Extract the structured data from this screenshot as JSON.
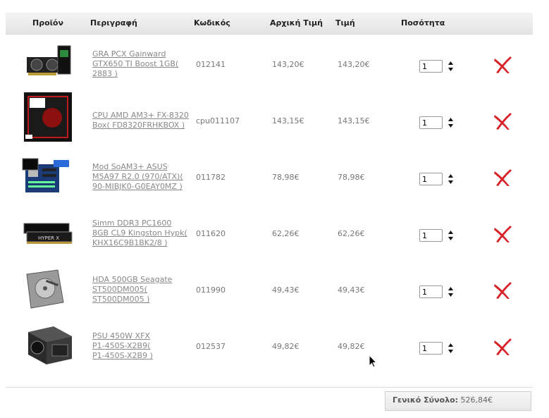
{
  "table": {
    "headers": {
      "product": "Προϊόν",
      "description": "Περιγραφή",
      "code": "Κωδικός",
      "original_price": "Αρχική Τιμή",
      "price": "Τιμή",
      "quantity": "Ποσότητα"
    },
    "rows": [
      {
        "desc": [
          "GRA PCX Gainward",
          "GTX650 TI Boost 1GB(",
          "2883 )"
        ],
        "code": "012141",
        "orig": "143,20€",
        "price": "143,20€",
        "qty": "1",
        "image": "graphics-card-image"
      },
      {
        "desc": [
          "CPU AMD AM3+ FX-8320",
          "Box( FD8320FRHKBOX )"
        ],
        "code": "cpu011107",
        "orig": "143,15€",
        "price": "143,15€",
        "qty": "1",
        "image": "cpu-box-image"
      },
      {
        "desc": [
          "Mod SoAM3+ ASUS",
          "M5A97 R2.0 (970/ATX)(",
          "90-MIBJK0-G0EAY0MZ )"
        ],
        "code": "011782",
        "orig": "78,98€",
        "price": "78,98€",
        "qty": "1",
        "image": "motherboard-image"
      },
      {
        "desc": [
          "Simm DDR3 PC1600",
          "8GB CL9 Kingston Hypk(",
          "KHX16C9B1BK2/8 )"
        ],
        "code": "011620",
        "orig": "62,26€",
        "price": "62,26€",
        "qty": "1",
        "image": "ram-module-image"
      },
      {
        "desc": [
          "HDA 500GB Seagate",
          "ST500DM005(",
          "ST500DM005 )"
        ],
        "code": "011990",
        "orig": "49,43€",
        "price": "49,43€",
        "qty": "1",
        "image": "hard-drive-image"
      },
      {
        "desc": [
          "PSU 450W XFX",
          "P1-450S-X2B9(",
          "P1-450S-X2B9 )"
        ],
        "code": "012537",
        "orig": "49,82€",
        "price": "49,82€",
        "qty": "1",
        "image": "power-supply-image"
      }
    ]
  },
  "summary": {
    "total_label": "Γενικό Σύνολο:",
    "total_value": "526,84€"
  },
  "icons": {
    "delete": "delete-x-icon",
    "spinner": "updown-arrows-icon",
    "cursor": "mouse-pointer-icon"
  },
  "colors": {
    "delete_red": "#d8232a",
    "header_bg": "#e9e9e9"
  }
}
